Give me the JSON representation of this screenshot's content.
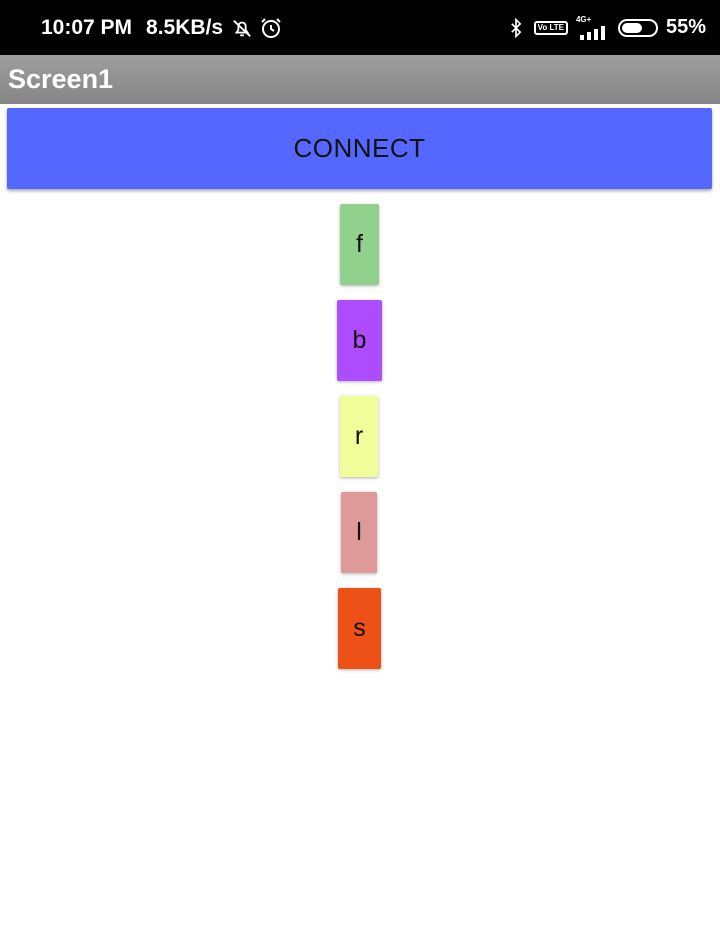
{
  "status_bar": {
    "time": "10:07 PM",
    "net_speed": "8.5KB/s",
    "volte": "Vo LTE",
    "network": "4G+",
    "battery": "55%",
    "icons": [
      "mute-bell-icon",
      "alarm-icon",
      "bluetooth-icon",
      "volte-icon",
      "signal-icon",
      "battery-icon"
    ]
  },
  "app": {
    "title": "Screen1"
  },
  "buttons": {
    "connect": "CONNECT",
    "forward": "f",
    "back": "b",
    "right": "r",
    "left": "l",
    "stop": "s"
  },
  "colors": {
    "connect": "#5468ff",
    "forward": "#92d08d",
    "back": "#ae4cff",
    "right": "#f1ff9b",
    "left": "#de9999",
    "stop": "#ee5118"
  }
}
